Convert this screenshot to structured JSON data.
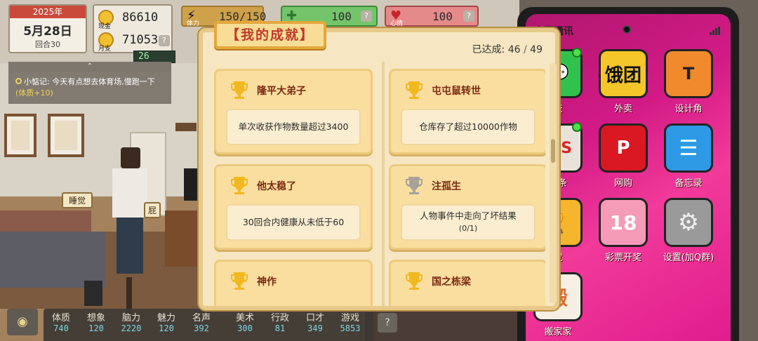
{
  "hud": {
    "year": "2025年",
    "date": "5月28日",
    "turn": "回合30",
    "cash_label": "现金",
    "cash_value": "86610",
    "expense_label": "月支",
    "expense_value": "71053",
    "help": "?",
    "energy_label": "体力",
    "energy_value": "150/150",
    "health_value": "100",
    "mood_label": "心情",
    "mood_value": "100",
    "clock": "26"
  },
  "memo": {
    "handle": "⌃",
    "prefix": "小惦记:",
    "text": "今天有点想去体育场,慢跑一下",
    "reward": "(体质+10)"
  },
  "scene": {
    "sleep_tag": "睡觉",
    "side_tag": "屁"
  },
  "stats": [
    {
      "name": "体质",
      "value": "740"
    },
    {
      "name": "想象",
      "value": "120"
    },
    {
      "name": "脑力",
      "value": "2220"
    },
    {
      "name": "魅力",
      "value": "120"
    },
    {
      "name": "名声",
      "value": "392"
    },
    {
      "name": "美术",
      "value": "300"
    },
    {
      "name": "行政",
      "value": "81"
    },
    {
      "name": "口才",
      "value": "349"
    },
    {
      "name": "游戏",
      "value": "5853"
    }
  ],
  "phone": {
    "title": "大国通讯",
    "apps": [
      {
        "name": "交",
        "glyph": "💬",
        "color": "#31c24d"
      },
      {
        "name": "外卖",
        "glyph": "饿团",
        "color": "#f5c62a"
      },
      {
        "name": "设计角",
        "glyph": "T",
        "color": "#f08a2c"
      },
      {
        "name": "头条",
        "glyph": "WS",
        "color": "#e8e2da"
      },
      {
        "name": "网购",
        "glyph": "P",
        "color": "#d91822"
      },
      {
        "name": "备忘录",
        "glyph": "☰",
        "color": "#2e9ae6"
      },
      {
        "name": "就",
        "glyph": "🏆",
        "color": "#f5b52c"
      },
      {
        "name": "彩票开奖",
        "glyph": "18",
        "color": "#f59ab7"
      },
      {
        "name": "设置(加Q群)",
        "glyph": "⚙",
        "color": "#9a9a9a"
      },
      {
        "name": "搬家家",
        "glyph": "搬",
        "color": "#f5efe4"
      }
    ]
  },
  "modal": {
    "title": "【我的成就】",
    "progress_label": "已达成:",
    "done": "46",
    "sep": "/",
    "total": "49",
    "achievements": [
      {
        "title": "隆平大弟子",
        "desc": "单次收获作物数量超过3400",
        "sub": "",
        "unlocked": true
      },
      {
        "title": "屯屯鼠转世",
        "desc": "仓库存了超过10000作物",
        "sub": "",
        "unlocked": true
      },
      {
        "title": "他太稳了",
        "desc": "30回合内健康从未低于60",
        "sub": "",
        "unlocked": true
      },
      {
        "title": "注孤生",
        "desc": "人物事件中走向了坏结果",
        "sub": "(0/1)",
        "unlocked": false
      },
      {
        "title": "神作",
        "desc": "",
        "sub": "",
        "unlocked": true
      },
      {
        "title": "国之栋梁",
        "desc": "",
        "sub": "",
        "unlocked": true
      }
    ]
  },
  "colors": {
    "gold": "#f2b820",
    "gray_trophy": "#a8a29a",
    "title_red": "#c0392b"
  }
}
